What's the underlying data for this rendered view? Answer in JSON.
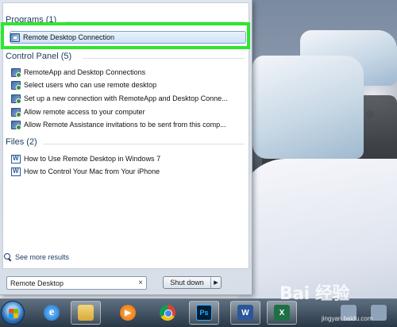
{
  "start_menu": {
    "groups": {
      "programs": {
        "header": "Programs (1)",
        "items": [
          "Remote Desktop Connection"
        ]
      },
      "control_panel": {
        "header": "Control Panel (5)",
        "items": [
          "RemoteApp and Desktop Connections",
          "Select users who can use remote desktop",
          "Set up a new connection with RemoteApp and Desktop Conne...",
          "Allow remote access to your computer",
          "Allow Remote Assistance invitations to be sent from this comp..."
        ]
      },
      "files": {
        "header": "Files (2)",
        "items": [
          "How to Use Remote Desktop in Windows 7",
          "How to Control Your Mac from Your iPhone"
        ]
      }
    },
    "see_more": "See more results",
    "search": {
      "value": "Remote Desktop",
      "clear": "×"
    },
    "shutdown": {
      "label": "Shut down",
      "arrow": "▶"
    }
  },
  "taskbar": {
    "ps_label": "Ps",
    "word_label": "W",
    "excel_label": "X"
  },
  "watermark": {
    "text": "Bai 经验",
    "sub": "jingyan.baidu.com"
  },
  "colors": {
    "highlight_frame": "#2ee62e",
    "selection": "#cde3fa",
    "taskbar": "#2a3d52"
  }
}
